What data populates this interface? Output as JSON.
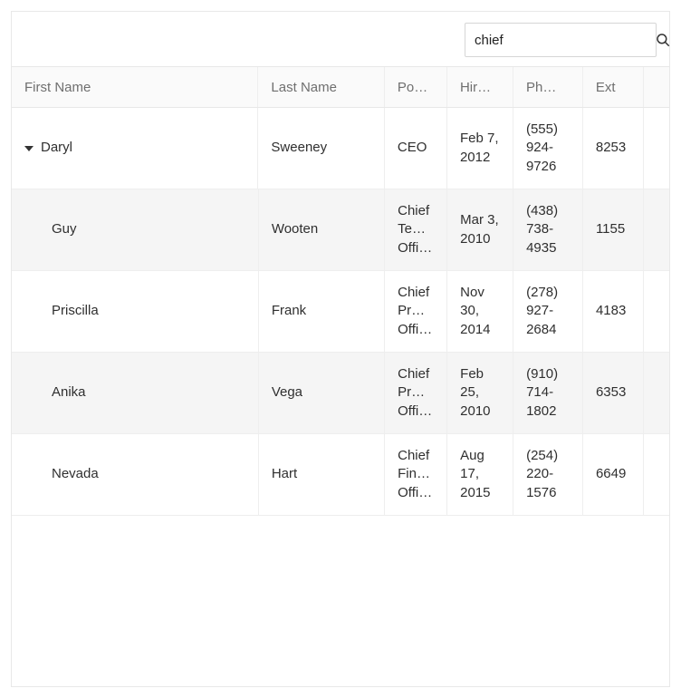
{
  "search": {
    "value": "chief"
  },
  "columns": {
    "firstName": "First Name",
    "lastName": "Last Name",
    "position": "Po…",
    "hireDate": "Hir…",
    "phone": "Ph…",
    "ext": "Ext"
  },
  "rows": [
    {
      "firstName": "Daryl",
      "lastName": "Sweeney",
      "position": "CEO",
      "hireDate": "Feb 7, 2012",
      "phone": "(555) 924-9726",
      "ext": "8253",
      "expanded": true,
      "level": 0
    },
    {
      "firstName": "Guy",
      "lastName": "Wooten",
      "position": "Chief Te… Offi…",
      "hireDate": "Mar 3, 2010",
      "phone": "(438) 738-4935",
      "ext": "1155",
      "level": 1
    },
    {
      "firstName": "Priscilla",
      "lastName": "Frank",
      "position": "Chief Pr… Offi…",
      "hireDate": "Nov 30, 2014",
      "phone": "(278) 927-2684",
      "ext": "4183",
      "level": 1
    },
    {
      "firstName": "Anika",
      "lastName": "Vega",
      "position": "Chief Pr… Offi…",
      "hireDate": "Feb 25, 2010",
      "phone": "(910) 714-1802",
      "ext": "6353",
      "level": 1
    },
    {
      "firstName": "Nevada",
      "lastName": "Hart",
      "position": "Chief Fin… Offi…",
      "hireDate": "Aug 17, 2015",
      "phone": "(254) 220-1576",
      "ext": "6649",
      "level": 1
    }
  ]
}
